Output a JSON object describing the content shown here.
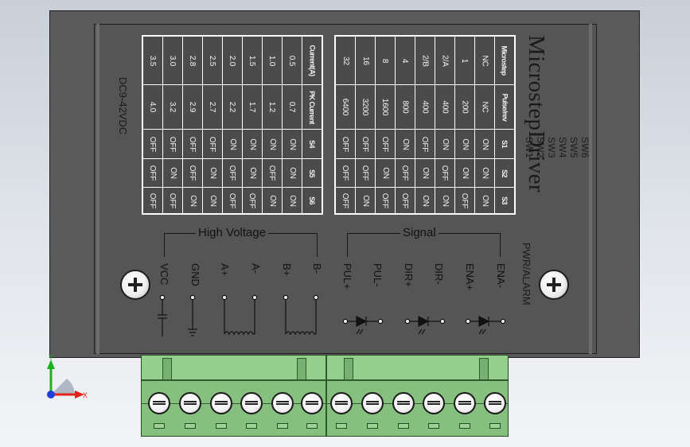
{
  "device": {
    "title": "MicrostepDriver",
    "model": "DC9-42VDC",
    "sw_labels": [
      "SW1",
      "SW2",
      "SW3",
      "SW4",
      "SW5",
      "SW6"
    ],
    "power_label": "PWR/ALARM",
    "groups": {
      "high_voltage": "High Voltage",
      "signal": "Signal"
    },
    "terminals": [
      "VCC",
      "GND",
      "A+",
      "A-",
      "B+",
      "B-",
      "PUL+",
      "PUL-",
      "DIR+",
      "DIR-",
      "ENA+",
      "ENA-"
    ]
  },
  "current_table": {
    "headers": [
      "Current(A)",
      "PK Current",
      "S4",
      "S5",
      "S6"
    ],
    "rows": [
      [
        "0.5",
        "0.7",
        "ON",
        "ON",
        "ON"
      ],
      [
        "1.0",
        "1.2",
        "ON",
        "OFF",
        "ON"
      ],
      [
        "1.5",
        "1.7",
        "ON",
        "ON",
        "OFF"
      ],
      [
        "2.0",
        "2.2",
        "ON",
        "OFF",
        "OFF"
      ],
      [
        "2.5",
        "2.7",
        "OFF",
        "ON",
        "ON"
      ],
      [
        "2.8",
        "2.9",
        "OFF",
        "OFF",
        "ON"
      ],
      [
        "3.0",
        "3.2",
        "OFF",
        "ON",
        "OFF"
      ],
      [
        "3.5",
        "4.0",
        "OFF",
        "OFF",
        "OFF"
      ]
    ]
  },
  "microstep_table": {
    "headers": [
      "Microstep",
      "Pulse/rev",
      "S1",
      "S2",
      "S3"
    ],
    "rows": [
      [
        "NC",
        "NC",
        "ON",
        "ON",
        "ON"
      ],
      [
        "1",
        "200",
        "ON",
        "ON",
        "OFF"
      ],
      [
        "2/A",
        "400",
        "ON",
        "OFF",
        "ON"
      ],
      [
        "2/B",
        "400",
        "OFF",
        "ON",
        "ON"
      ],
      [
        "4",
        "800",
        "ON",
        "OFF",
        "OFF"
      ],
      [
        "8",
        "1600",
        "OFF",
        "ON",
        "OFF"
      ],
      [
        "16",
        "3200",
        "OFF",
        "OFF",
        "ON"
      ],
      [
        "32",
        "6400",
        "OFF",
        "OFF",
        "OFF"
      ]
    ]
  },
  "triad": {
    "y_label": "Y",
    "x_label": "X",
    "colors": {
      "x": "#e0241c",
      "y": "#1bb31b",
      "z": "#1f3fd8"
    }
  }
}
